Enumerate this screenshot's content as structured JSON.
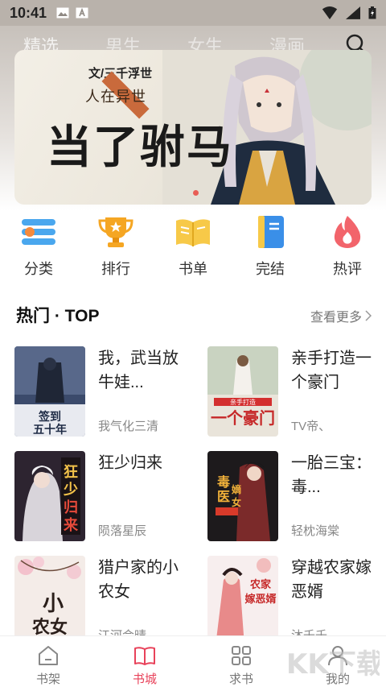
{
  "status_bar": {
    "time": "10:41"
  },
  "tabs": [
    {
      "label": "精选"
    },
    {
      "label": "男生"
    },
    {
      "label": "女生"
    },
    {
      "label": "漫画"
    }
  ],
  "banner": {
    "author": "文/三千浮世",
    "subtitle": "人在异世",
    "title": "当了驸马"
  },
  "categories": [
    {
      "label": "分类",
      "icon": "list-icon",
      "color": "#3aa0e8"
    },
    {
      "label": "排行",
      "icon": "trophy-icon",
      "color": "#f5a623"
    },
    {
      "label": "书单",
      "icon": "book-open-icon",
      "color": "#f7c948"
    },
    {
      "label": "完结",
      "icon": "book-closed-icon",
      "color": "#3a8fe8"
    },
    {
      "label": "热评",
      "icon": "flame-icon",
      "color": "#f2646b"
    }
  ],
  "section": {
    "title": "热门 · TOP",
    "more": "查看更多"
  },
  "books": [
    {
      "title": "我，武当放牛娃...",
      "author": "我气化三清",
      "cover_text": "签到五十年",
      "cover_color": "#3b4a6b"
    },
    {
      "title": "亲手打造一个豪门",
      "author": "TV帝、",
      "cover_text": "亲手打造一个豪门",
      "cover_color": "#e9e4da"
    },
    {
      "title": "狂少归来",
      "author": "陨落星辰",
      "cover_text": "狂少归来",
      "cover_color": "#2d2430"
    },
    {
      "title": "一胎三宝：毒...",
      "author": "轻枕海棠",
      "cover_text": "毒医嫡女",
      "cover_color": "#1d1a1c"
    },
    {
      "title": "猎户家的小农女",
      "author": "江河会晴",
      "cover_text": "小农女",
      "cover_color": "#f4ece8"
    },
    {
      "title": "穿越农家嫁恶婿",
      "author": "沐千千",
      "cover_text": "农家嫁恶婿",
      "cover_color": "#f7eeee"
    }
  ],
  "bottom_nav": [
    {
      "label": "书架",
      "icon": "home-icon"
    },
    {
      "label": "书城",
      "icon": "book-open-icon"
    },
    {
      "label": "求书",
      "icon": "grid-icon"
    },
    {
      "label": "我的",
      "icon": "user-icon"
    }
  ],
  "watermark": {
    "text": "KK下载"
  }
}
